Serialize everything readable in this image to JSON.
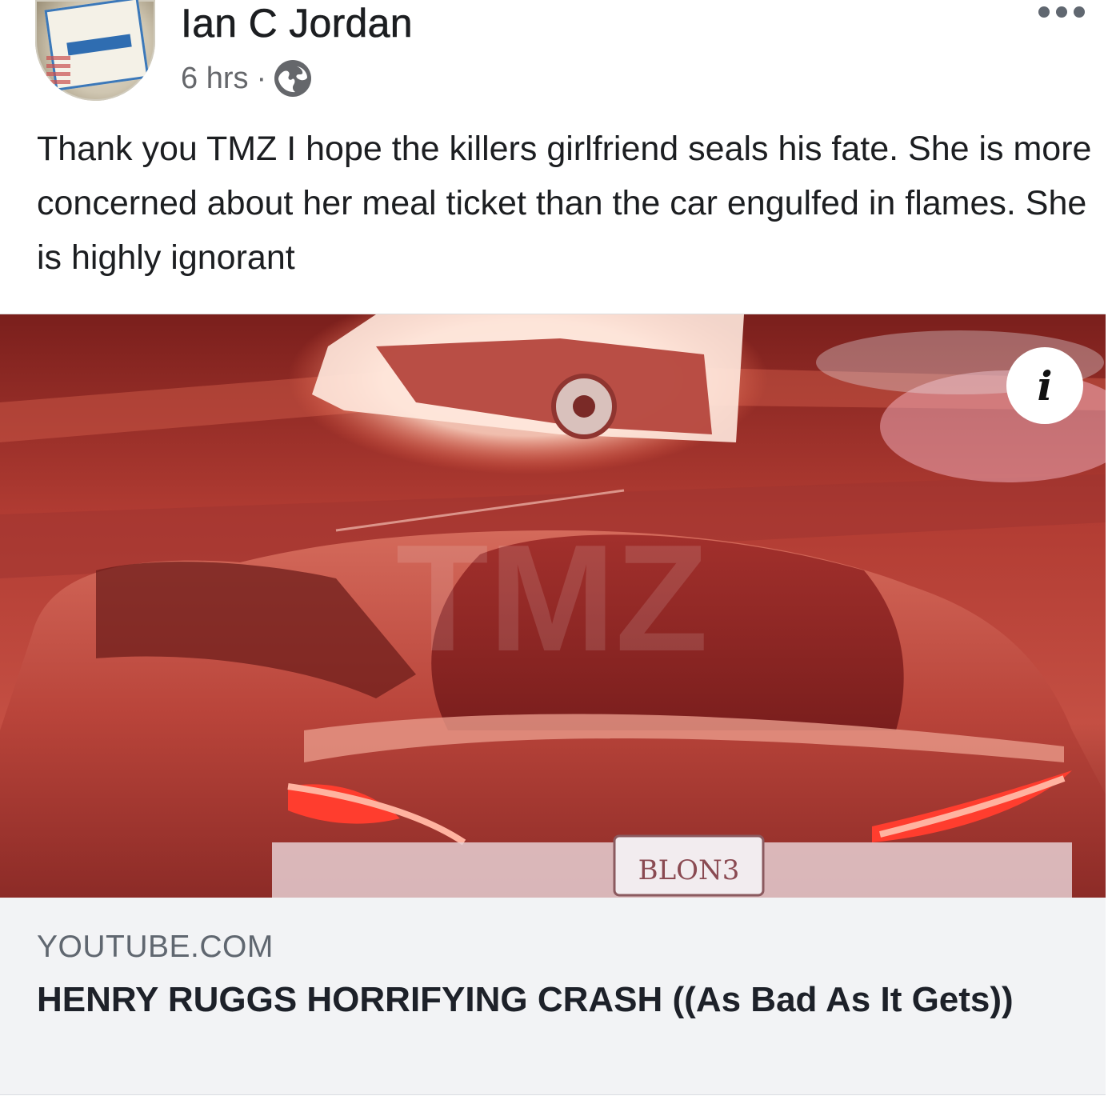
{
  "post": {
    "author": "Ian C Jordan",
    "time": "6 hrs",
    "separator": "·",
    "privacy_icon": "globe-icon",
    "more_icon": "more-options-icon",
    "text": "Thank you TMZ I hope the killers girlfriend seals his fate. She is more concerned about her meal ticket than the car engulfed in flames. She is highly ignorant"
  },
  "media": {
    "info_label": "i",
    "watermark": "TMZ",
    "plate_text": "BLON3"
  },
  "link_preview": {
    "domain": "YOUTUBE.COM",
    "title": "HENRY RUGGS HORRIFYING CRASH ((As Bad As It Gets))"
  },
  "colors": {
    "meta_gray": "#65676b",
    "preview_bg": "#f2f3f5",
    "title_text": "#1d2129"
  }
}
